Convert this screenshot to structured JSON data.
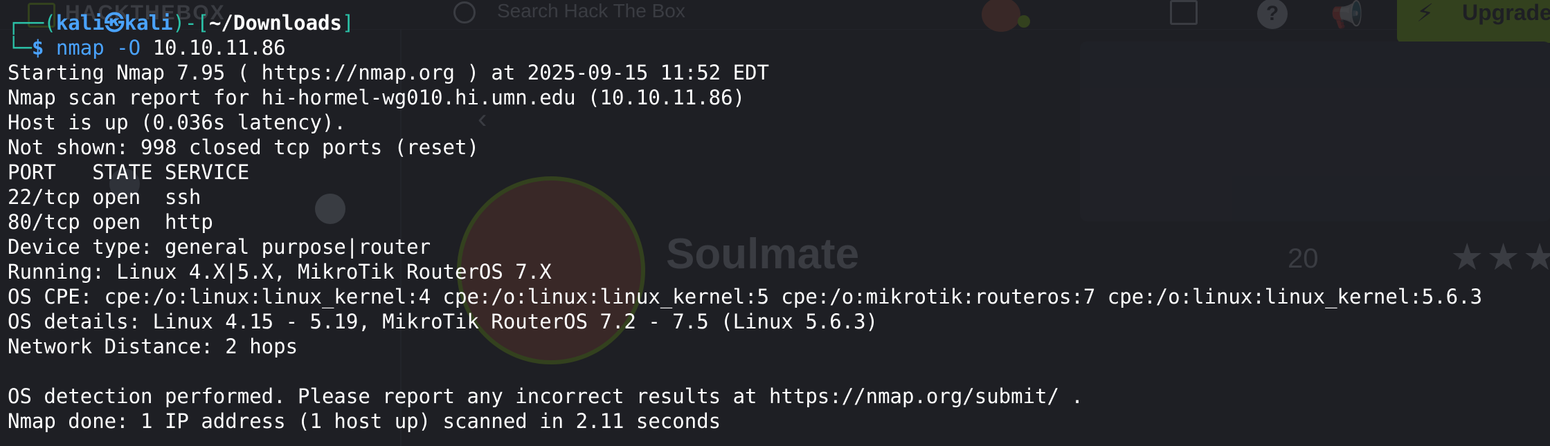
{
  "background": {
    "brand": "HACKTHEBOX",
    "search_placeholder": "Search Hack The Box",
    "upgrade_label": "Upgrade",
    "machine_name": "Soulmate",
    "machine_count": "20",
    "accent_color": "#9fef00"
  },
  "terminal": {
    "prompt": {
      "corner_top": "┌──(",
      "user": "kali",
      "separator_icon": "kali-dragon-icon",
      "host": "kali",
      "mid": ")-[",
      "cwd": "~/Downloads",
      "close": "]",
      "corner_bottom": "└─",
      "dollar": "$",
      "command": "nmap",
      "args": "-O",
      "target": "10.10.11.86"
    },
    "output": [
      "Starting Nmap 7.95 ( https://nmap.org ) at 2025-09-15 11:52 EDT",
      "Nmap scan report for hi-hormel-wg010.hi.umn.edu (10.10.11.86)",
      "Host is up (0.036s latency).",
      "Not shown: 998 closed tcp ports (reset)",
      "PORT   STATE SERVICE",
      "22/tcp open  ssh",
      "80/tcp open  http",
      "Device type: general purpose|router",
      "Running: Linux 4.X|5.X, MikroTik RouterOS 7.X",
      "OS CPE: cpe:/o:linux:linux_kernel:4 cpe:/o:linux:linux_kernel:5 cpe:/o:mikrotik:routeros:7 cpe:/o:linux:linux_kernel:5.6.3",
      "OS details: Linux 4.15 - 5.19, MikroTik RouterOS 7.2 - 7.5 (Linux 5.6.3)",
      "Network Distance: 2 hops",
      "",
      "OS detection performed. Please report any incorrect results at https://nmap.org/submit/ .",
      "Nmap done: 1 IP address (1 host up) scanned in 2.11 seconds"
    ]
  }
}
